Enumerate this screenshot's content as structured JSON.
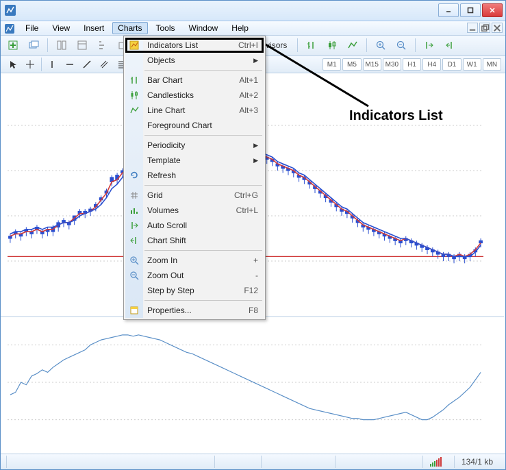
{
  "titlebar": {
    "minimize": "min",
    "maximize": "max",
    "close": "close"
  },
  "menubar": {
    "items": [
      "File",
      "View",
      "Insert",
      "Charts",
      "Tools",
      "Window",
      "Help"
    ],
    "active_index": 3
  },
  "toolbar": {
    "expert_advisors": "Expert Advisors"
  },
  "timeframes": [
    "M1",
    "M5",
    "M15",
    "M30",
    "H1",
    "H4",
    "D1",
    "W1",
    "MN"
  ],
  "dropdown": {
    "items": [
      {
        "label": "Indicators List",
        "shortcut": "Ctrl+I",
        "icon": "indicators-icon"
      },
      {
        "label": "Objects",
        "sub": true
      },
      {
        "sep": true
      },
      {
        "label": "Bar Chart",
        "shortcut": "Alt+1",
        "icon": "bar-chart-icon"
      },
      {
        "label": "Candlesticks",
        "shortcut": "Alt+2",
        "icon": "candlestick-icon"
      },
      {
        "label": "Line Chart",
        "shortcut": "Alt+3",
        "icon": "line-chart-icon"
      },
      {
        "label": "Foreground Chart"
      },
      {
        "sep": true
      },
      {
        "label": "Periodicity",
        "sub": true
      },
      {
        "label": "Template",
        "sub": true
      },
      {
        "label": "Refresh",
        "icon": "refresh-icon"
      },
      {
        "sep": true
      },
      {
        "label": "Grid",
        "shortcut": "Ctrl+G",
        "icon": "grid-icon"
      },
      {
        "label": "Volumes",
        "shortcut": "Ctrl+L",
        "icon": "volumes-icon"
      },
      {
        "label": "Auto Scroll",
        "icon": "autoscroll-icon"
      },
      {
        "label": "Chart Shift",
        "icon": "chartshift-icon"
      },
      {
        "sep": true
      },
      {
        "label": "Zoom In",
        "shortcut": "+",
        "icon": "zoom-in-icon"
      },
      {
        "label": "Zoom Out",
        "shortcut": "-",
        "icon": "zoom-out-icon"
      },
      {
        "label": "Step by Step",
        "shortcut": "F12"
      },
      {
        "sep": true
      },
      {
        "label": "Properties...",
        "shortcut": "F8",
        "icon": "properties-icon"
      }
    ]
  },
  "callout": {
    "text": "Indicators List"
  },
  "status": {
    "transfer": "134/1 kb"
  },
  "chart_data": {
    "type": "line",
    "title": "",
    "main_panel": {
      "ylim": [
        0,
        100
      ],
      "red_line_y": 22,
      "series": [
        {
          "name": "candlesticks",
          "type": "candlestick",
          "open": [
            30,
            32,
            31,
            33,
            32,
            34,
            32,
            33,
            33,
            35,
            37,
            36,
            38,
            41,
            41,
            42,
            44,
            47,
            50,
            55,
            56,
            59,
            60,
            62,
            63,
            65,
            66,
            68,
            70,
            70,
            69,
            70,
            70,
            69,
            70,
            72,
            72,
            73,
            72,
            73,
            73,
            72,
            71,
            70,
            69,
            68,
            67,
            66,
            65,
            64,
            62,
            61,
            60,
            59,
            57,
            56,
            54,
            52,
            50,
            48,
            46,
            44,
            42,
            41,
            39,
            37,
            35,
            34,
            33,
            32,
            31,
            30,
            29,
            28,
            29,
            28,
            27,
            26,
            25,
            24,
            23,
            22,
            22,
            21,
            22,
            21,
            22,
            24,
            28
          ],
          "high": [
            32,
            34,
            33,
            35,
            34,
            36,
            34,
            35,
            36,
            38,
            39,
            38,
            40,
            43,
            43,
            44,
            46,
            49,
            52,
            58,
            59,
            61,
            62,
            64,
            65,
            67,
            68,
            70,
            72,
            72,
            71,
            72,
            72,
            71,
            72,
            74,
            74,
            75,
            74,
            75,
            75,
            74,
            73,
            72,
            71,
            70,
            69,
            68,
            67,
            66,
            64,
            63,
            62,
            61,
            59,
            58,
            56,
            54,
            52,
            50,
            48,
            46,
            44,
            43,
            41,
            39,
            37,
            36,
            35,
            34,
            33,
            32,
            31,
            30,
            31,
            30,
            29,
            28,
            27,
            26,
            25,
            24,
            24,
            23,
            24,
            23,
            24,
            26,
            30
          ],
          "low": [
            28,
            30,
            29,
            31,
            30,
            32,
            30,
            31,
            31,
            33,
            35,
            34,
            36,
            39,
            39,
            40,
            42,
            45,
            48,
            53,
            54,
            57,
            58,
            60,
            61,
            63,
            64,
            66,
            68,
            68,
            67,
            68,
            68,
            67,
            68,
            70,
            70,
            71,
            70,
            71,
            71,
            70,
            69,
            68,
            67,
            66,
            65,
            64,
            63,
            62,
            60,
            59,
            58,
            57,
            55,
            54,
            52,
            50,
            48,
            46,
            44,
            42,
            40,
            39,
            37,
            35,
            33,
            32,
            31,
            30,
            29,
            28,
            27,
            26,
            27,
            26,
            25,
            24,
            23,
            22,
            21,
            20,
            20,
            19,
            20,
            19,
            20,
            22,
            26
          ],
          "close": [
            31,
            33,
            32,
            34,
            33,
            35,
            33,
            34,
            35,
            37,
            38,
            37,
            40,
            42,
            42,
            43,
            45,
            48,
            51,
            57,
            58,
            60,
            61,
            63,
            64,
            66,
            67,
            69,
            71,
            71,
            70,
            71,
            71,
            70,
            71,
            73,
            73,
            74,
            73,
            74,
            74,
            73,
            72,
            71,
            70,
            69,
            68,
            67,
            66,
            65,
            63,
            62,
            61,
            60,
            58,
            57,
            55,
            53,
            51,
            49,
            47,
            45,
            43,
            42,
            40,
            38,
            36,
            35,
            34,
            33,
            32,
            31,
            30,
            29,
            30,
            29,
            28,
            27,
            26,
            25,
            24,
            23,
            23,
            22,
            23,
            22,
            23,
            25,
            29
          ]
        },
        {
          "name": "ma_red",
          "color": "#d03a3a",
          "values": [
            31,
            32,
            32,
            33,
            33,
            34,
            33,
            34,
            34,
            36,
            37,
            37,
            39,
            41,
            41,
            42,
            44,
            47,
            50,
            55,
            56,
            59,
            60,
            62,
            63,
            65,
            66,
            68,
            70,
            70,
            70,
            71,
            71,
            70,
            71,
            72,
            72,
            73,
            72,
            73,
            73,
            72,
            72,
            71,
            70,
            69,
            68,
            67,
            66,
            65,
            63,
            62,
            61,
            60,
            58,
            57,
            55,
            53,
            51,
            49,
            47,
            45,
            43,
            42,
            40,
            38,
            36,
            35,
            34,
            33,
            32,
            31,
            30,
            29,
            30,
            29,
            28,
            27,
            26,
            25,
            24,
            23,
            23,
            22,
            23,
            22,
            23,
            25,
            28
          ]
        },
        {
          "name": "ma_blue",
          "color": "#2a4fd0",
          "values": [
            32,
            33,
            33,
            34,
            34,
            35,
            34,
            35,
            35,
            36,
            37,
            37,
            38,
            40,
            41,
            42,
            43,
            45,
            48,
            52,
            54,
            57,
            59,
            61,
            62,
            64,
            65,
            67,
            69,
            70,
            70,
            71,
            71,
            71,
            71,
            72,
            72,
            73,
            73,
            73,
            73,
            73,
            72,
            71,
            70,
            70,
            69,
            68,
            67,
            66,
            64,
            63,
            62,
            61,
            59,
            58,
            56,
            54,
            52,
            50,
            48,
            46,
            44,
            43,
            41,
            39,
            37,
            36,
            35,
            34,
            33,
            32,
            31,
            30,
            30,
            29,
            28,
            27,
            26,
            25,
            24,
            23,
            23,
            22,
            22,
            22,
            22,
            24,
            27
          ]
        }
      ]
    },
    "sub_panel": {
      "ylim": [
        0,
        100
      ],
      "series": [
        {
          "name": "oscillator",
          "color": "#5a8fc7",
          "values": [
            40,
            42,
            50,
            48,
            55,
            57,
            60,
            58,
            62,
            65,
            68,
            70,
            72,
            74,
            76,
            80,
            82,
            84,
            85,
            86,
            87,
            88,
            88,
            87,
            88,
            87,
            86,
            85,
            84,
            82,
            80,
            78,
            76,
            74,
            73,
            71,
            69,
            67,
            65,
            63,
            61,
            59,
            57,
            55,
            53,
            51,
            49,
            47,
            45,
            43,
            41,
            39,
            37,
            35,
            33,
            31,
            29,
            28,
            27,
            26,
            25,
            24,
            23,
            22,
            21,
            21,
            20,
            20,
            20,
            21,
            22,
            23,
            24,
            25,
            26,
            24,
            22,
            20,
            20,
            22,
            25,
            28,
            32,
            35,
            38,
            42,
            46,
            52,
            58
          ]
        }
      ]
    }
  }
}
